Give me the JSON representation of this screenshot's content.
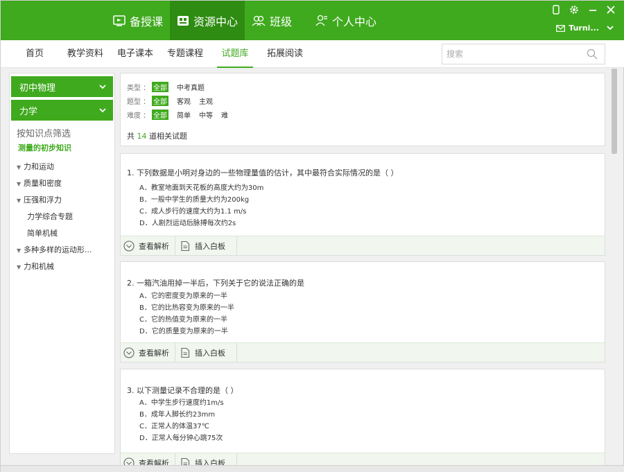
{
  "colors": {
    "brand_green": "#3faa1e",
    "brand_green_dark": "#2e8c12"
  },
  "topnav": {
    "items": [
      {
        "label": "备授课",
        "icon": "lesson-icon"
      },
      {
        "label": "资源中心",
        "icon": "resource-icon",
        "active": true
      },
      {
        "label": "班级",
        "icon": "class-icon"
      },
      {
        "label": "个人中心",
        "icon": "profile-icon"
      }
    ]
  },
  "user": {
    "name": "Turni..."
  },
  "subnav": {
    "items": [
      "首页",
      "教学资料",
      "电子课本",
      "专题课程",
      "试题库",
      "拓展阅读"
    ],
    "active_index": 4
  },
  "search": {
    "placeholder": "搜索"
  },
  "sidebar": {
    "grade": "初中物理",
    "subject": "力学",
    "filter_title": "按知识点筛选",
    "filter_current": "测量的初步知识",
    "tree": [
      {
        "label": "力和运动",
        "expandable": true
      },
      {
        "label": "质量和密度",
        "expandable": true
      },
      {
        "label": "压强和浮力",
        "expandable": true
      },
      {
        "label": "力学综合专题",
        "expandable": false
      },
      {
        "label": "简单机械",
        "expandable": false
      },
      {
        "label": "多种多样的运动形...",
        "expandable": true
      },
      {
        "label": "力和机械",
        "expandable": true
      }
    ]
  },
  "filters": {
    "type": {
      "label": "类型 ：",
      "options": [
        "全部",
        "中考真题"
      ],
      "selected": 0
    },
    "qtype": {
      "label": "题型 ：",
      "options": [
        "全部",
        "客观",
        "主观"
      ],
      "selected": 0
    },
    "difficulty": {
      "label": "难度 ：",
      "options": [
        "全部",
        "简单",
        "中等",
        "难"
      ],
      "selected": 0
    },
    "count_prefix": "共",
    "count": "14",
    "count_suffix": "道相关试题"
  },
  "actions": {
    "analysis": "查看解析",
    "insert": "插入白板"
  },
  "questions": [
    {
      "title": "1.  下列数据是小明对身边的一些物理量值的估计，其中最符合实际情况的是（            ）",
      "options": [
        "A．教室地面到天花板的高度大约为30m",
        "B．一般中学生的质量大约为200kg",
        "C．成人步行的速度大约为1.1 m/s",
        "D．人剧烈运动后脉搏每次约2s"
      ]
    },
    {
      "title": "2.  一箱汽油用掉一半后，下列关于它的说法正确的是",
      "options": [
        "A．它的密度变为原来的一半",
        "B．它的比热容变为原来的一半",
        "C．它的热值变为原来的一半",
        "D．它的质量变为原来的一半"
      ]
    },
    {
      "title": "3.  以下测量记录不合理的是（     ）",
      "options": [
        "A．中学生步行速度约1m/s",
        "B．成年人脚长约23mm",
        "C．正常人的体温37℃",
        "D．正常人每分钟心跳75次"
      ]
    }
  ]
}
